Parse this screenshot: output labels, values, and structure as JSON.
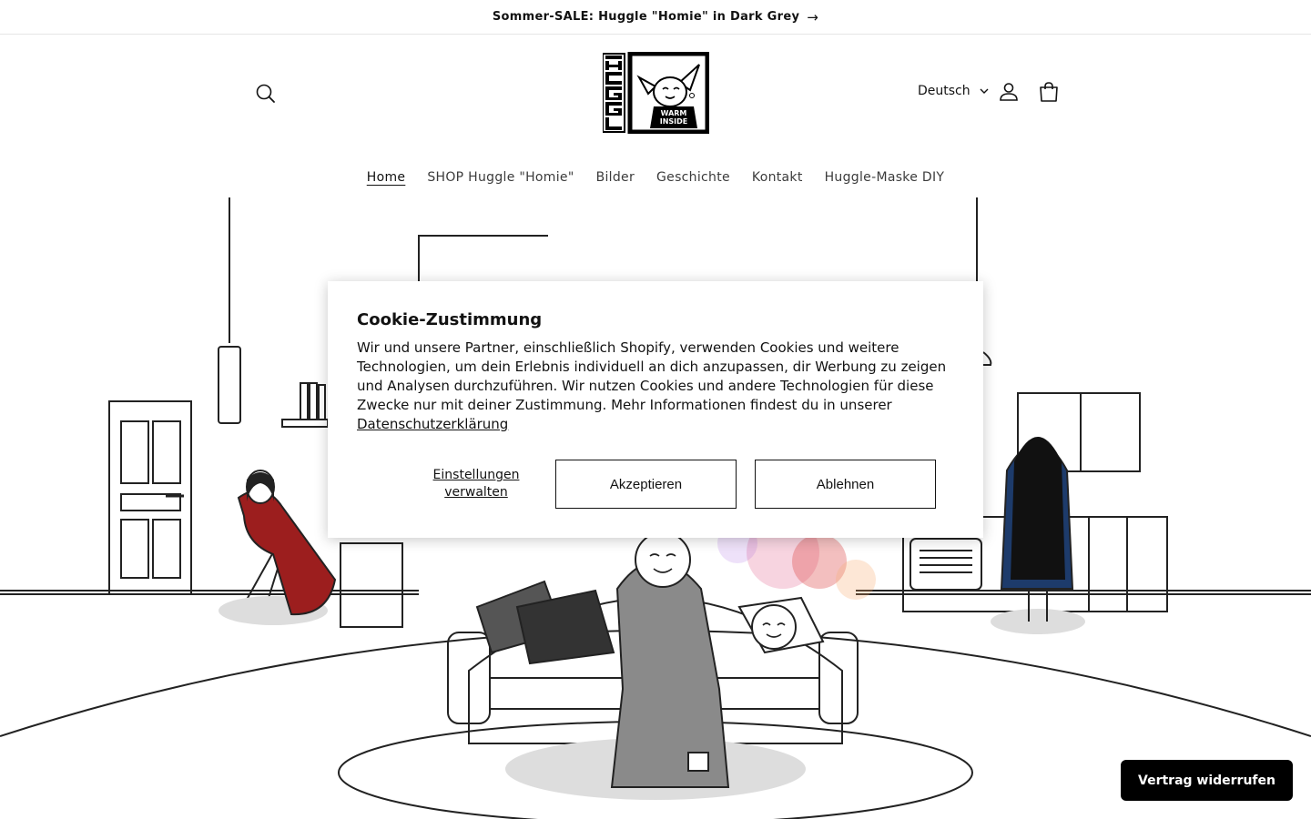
{
  "announcement": {
    "text": "Sommer-SALE: Huggle \"Homie\" in Dark Grey",
    "arrow": "→"
  },
  "header": {
    "logo": {
      "brand_text": "HUGGLE",
      "badge_text_1": "WARM",
      "badge_text_2": "INSIDE"
    },
    "language": {
      "selected": "Deutsch"
    }
  },
  "nav": {
    "items": [
      {
        "label": "Home"
      },
      {
        "label": "SHOP Huggle \"Homie\""
      },
      {
        "label": "Bilder"
      },
      {
        "label": "Geschichte"
      },
      {
        "label": "Kontakt"
      },
      {
        "label": "Huggle-Maske DIY"
      }
    ]
  },
  "cookie": {
    "title": "Cookie-Zustimmung",
    "body": "Wir und unsere Partner, einschließlich Shopify, verwenden Cookies und weitere Technologien, um dein Erlebnis individuell an dich anzupassen, dir Werbung zu zeigen und Analysen durchzuführen. Wir nutzen Cookies und andere Technologien für diese Zwecke nur mit deiner Zustimmung. Mehr Informationen findest du in unserer ",
    "policy_link": "Datenschutzerklärung",
    "manage_line1": "Einstellungen",
    "manage_line2": "verwalten",
    "accept": "Akzeptieren",
    "decline": "Ablehnen"
  },
  "withdraw": {
    "label": "Vertrag widerrufen"
  },
  "colors": {
    "text": "#121212",
    "nav_text": "#3b3b3b",
    "withdraw_bg": "#000000",
    "huggle_red": "#a11d1d",
    "huggle_blue": "#1d3b6b",
    "huggle_grey": "#7a7a7a"
  }
}
